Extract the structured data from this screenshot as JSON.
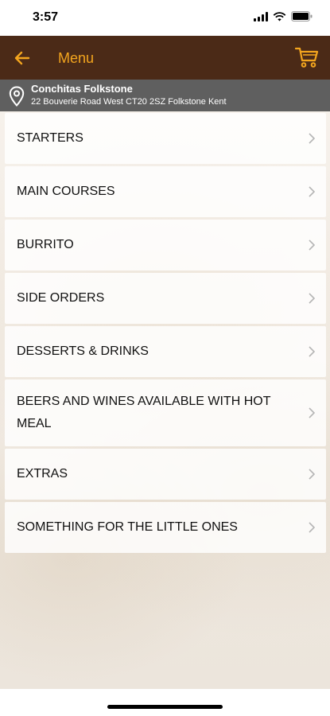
{
  "status_bar": {
    "time": "3:57"
  },
  "header": {
    "title": "Menu"
  },
  "store": {
    "name": "Conchitas Folkstone",
    "address": "22 Bouverie Road West CT20 2SZ Folkstone Kent"
  },
  "menu": {
    "items": [
      {
        "label": "STARTERS"
      },
      {
        "label": "MAIN COURSES"
      },
      {
        "label": "BURRITO"
      },
      {
        "label": "SIDE ORDERS"
      },
      {
        "label": "DESSERTS & DRINKS"
      },
      {
        "label": "BEERS AND WINES AVAILABLE WITH HOT MEAL"
      },
      {
        "label": "EXTRAS"
      },
      {
        "label": "SOMETHING FOR THE LITTLE ONES"
      }
    ]
  },
  "colors": {
    "header_bg": "#4b2a17",
    "accent": "#f3a51e",
    "store_bar_bg": "#5f5f5f"
  },
  "icons": [
    "back-arrow-icon",
    "cart-icon",
    "location-pin-icon",
    "chevron-right-icon",
    "wifi-icon",
    "battery-icon",
    "signal-icon"
  ]
}
